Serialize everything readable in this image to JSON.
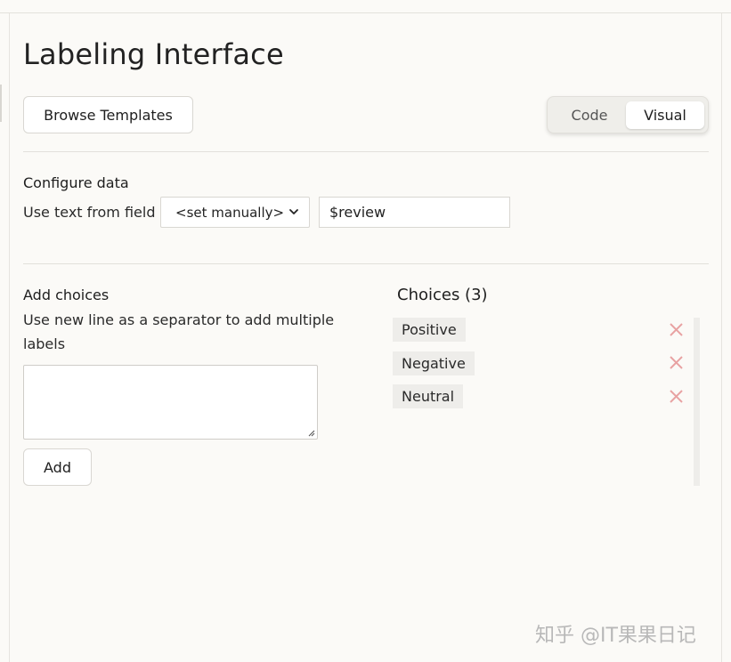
{
  "page": {
    "title": "Labeling Interface"
  },
  "toolbar": {
    "browse_label": "Browse Templates",
    "view_toggle": {
      "options": [
        "Code",
        "Visual"
      ],
      "selected": "Visual"
    }
  },
  "configure": {
    "title": "Configure data",
    "field_label": "Use text from field",
    "select_value": "<set manually>",
    "input_value": "$review"
  },
  "add_choices": {
    "title": "Add choices",
    "description": "Use new line as a separator to add multiple labels",
    "textarea_value": "",
    "add_label": "Add"
  },
  "choices": {
    "title": "Choices (3)",
    "items": [
      "Positive",
      "Negative",
      "Neutral"
    ]
  },
  "colors": {
    "accent_remove": "#e8a2a2",
    "background": "#fbfaf7"
  },
  "watermark": "知乎 @IT果果日记"
}
